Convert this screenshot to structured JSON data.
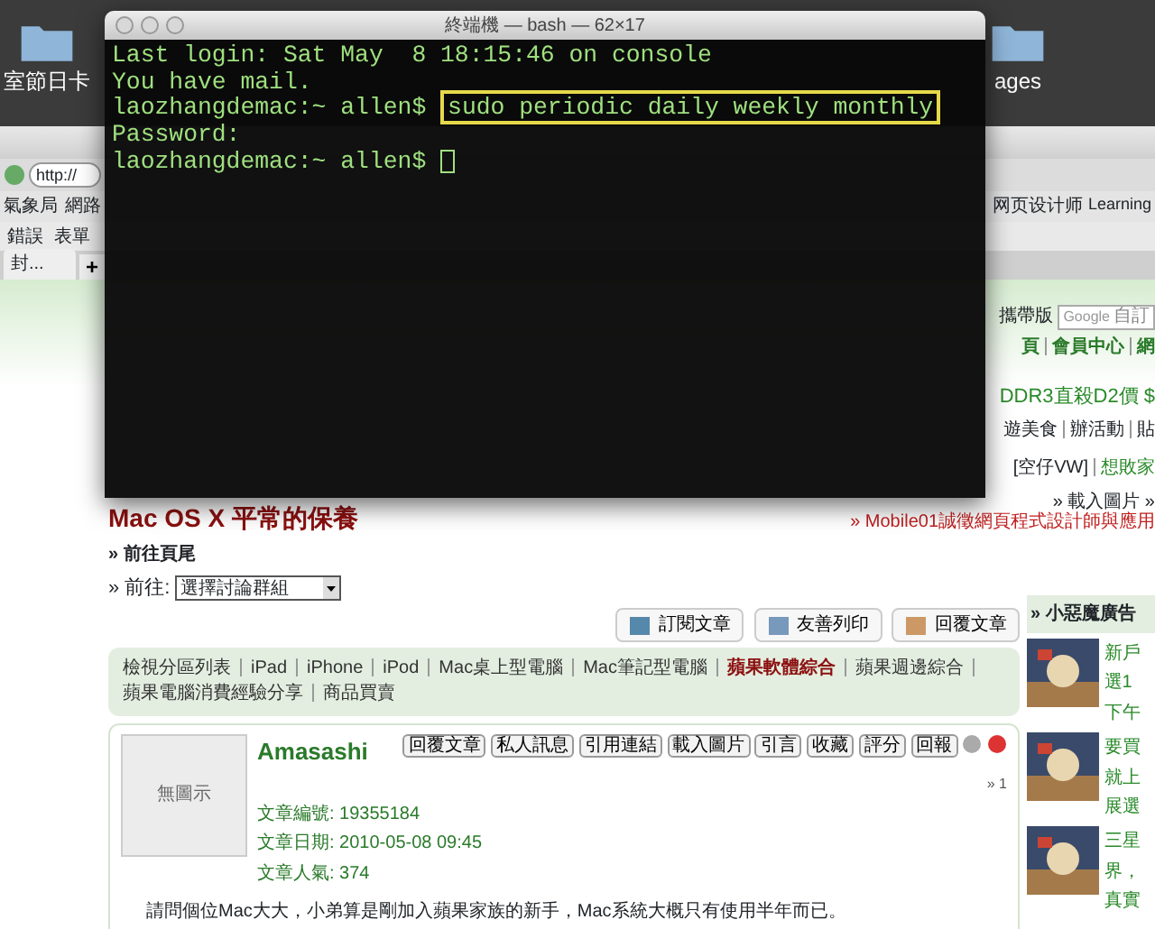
{
  "desktop": {
    "icons": [
      {
        "label": "室節日卡"
      },
      {
        "label": "ages"
      }
    ]
  },
  "terminal": {
    "title": "終端機 — bash — 62×17",
    "lines": [
      {
        "kind": "output",
        "text": "Last login: Sat May  8 18:15:46 on console"
      },
      {
        "kind": "output",
        "text": "You have mail."
      },
      {
        "kind": "prompt",
        "prompt": "laozhangdemac:~ allen$",
        "command": "sudo periodic daily weekly monthly",
        "highlighted": true,
        "cursor": false
      },
      {
        "kind": "output",
        "text": "Password:"
      },
      {
        "kind": "prompt",
        "prompt": "laozhangdemac:~ allen$",
        "cursor": true
      }
    ]
  },
  "browser": {
    "url": "http://",
    "bookmarks_left": [
      "氣象局",
      "網路"
    ],
    "bookmarks_right": [
      "网页设计师",
      "Learning"
    ],
    "toolbar": [
      "錯誤",
      "表單"
    ],
    "tabs": [
      {
        "label": "封...",
        "selected": true
      }
    ],
    "new_tab": "+"
  },
  "header": {
    "mobile_label": "攜帶版",
    "search_logo": "Google",
    "search_placeholder": "自訂",
    "top_links": [
      "頁",
      "會員中心",
      "網"
    ],
    "ad_text": "DDR3直殺D2價 $",
    "category_links": [
      "遊美食",
      "辦活動",
      "貼"
    ],
    "sub_links": [
      "[空仔VW]",
      "想敗家"
    ],
    "load_images": "» 載入圖片 »"
  },
  "topic": {
    "title": "Mac OS X 平常的保養",
    "recruit": "» Mobile01誠徵網頁程式設計師與應用",
    "goto_bottom": "» 前往頁尾",
    "goto_label": "» 前往:",
    "goto_select": "選擇討論群組"
  },
  "actions": [
    "訂閱文章",
    "友善列印",
    "回覆文章"
  ],
  "forum_nav": [
    {
      "label": "檢視分區列表",
      "selected": false
    },
    {
      "label": "iPad",
      "selected": false
    },
    {
      "label": "iPhone",
      "selected": false
    },
    {
      "label": "iPod",
      "selected": false
    },
    {
      "label": "Mac桌上型電腦",
      "selected": false
    },
    {
      "label": "Mac筆記型電腦",
      "selected": false
    },
    {
      "label": "蘋果軟體綜合",
      "selected": true
    },
    {
      "label": "蘋果週邊綜合",
      "selected": false
    },
    {
      "label": "蘋果電腦消費經驗分享",
      "selected": false
    },
    {
      "label": "商品買賣",
      "selected": false
    }
  ],
  "post": {
    "author": "Amasashi",
    "avatar_text": "無圖示",
    "buttons": [
      "回覆文章",
      "私人訊息",
      "引用連結",
      "載入圖片",
      "引言",
      "收藏",
      "評分",
      "回報"
    ],
    "meta": [
      "文章編號: 19355184",
      "文章日期: 2010-05-08 09:45",
      "文章人氣: 374"
    ],
    "pager": "» 1",
    "body": "請問個位Mac大大，小弟算是剛加入蘋果家族的新手，Mac系統大概只有使用半年而已。"
  },
  "sidebar": {
    "title": "» 小惡魔廣告",
    "items": [
      {
        "lines": [
          "新戶",
          "選1",
          "下午"
        ]
      },
      {
        "lines": [
          "要買",
          "就上",
          "展選"
        ]
      },
      {
        "lines": [
          "三星",
          "界，",
          "真實"
        ]
      }
    ]
  }
}
